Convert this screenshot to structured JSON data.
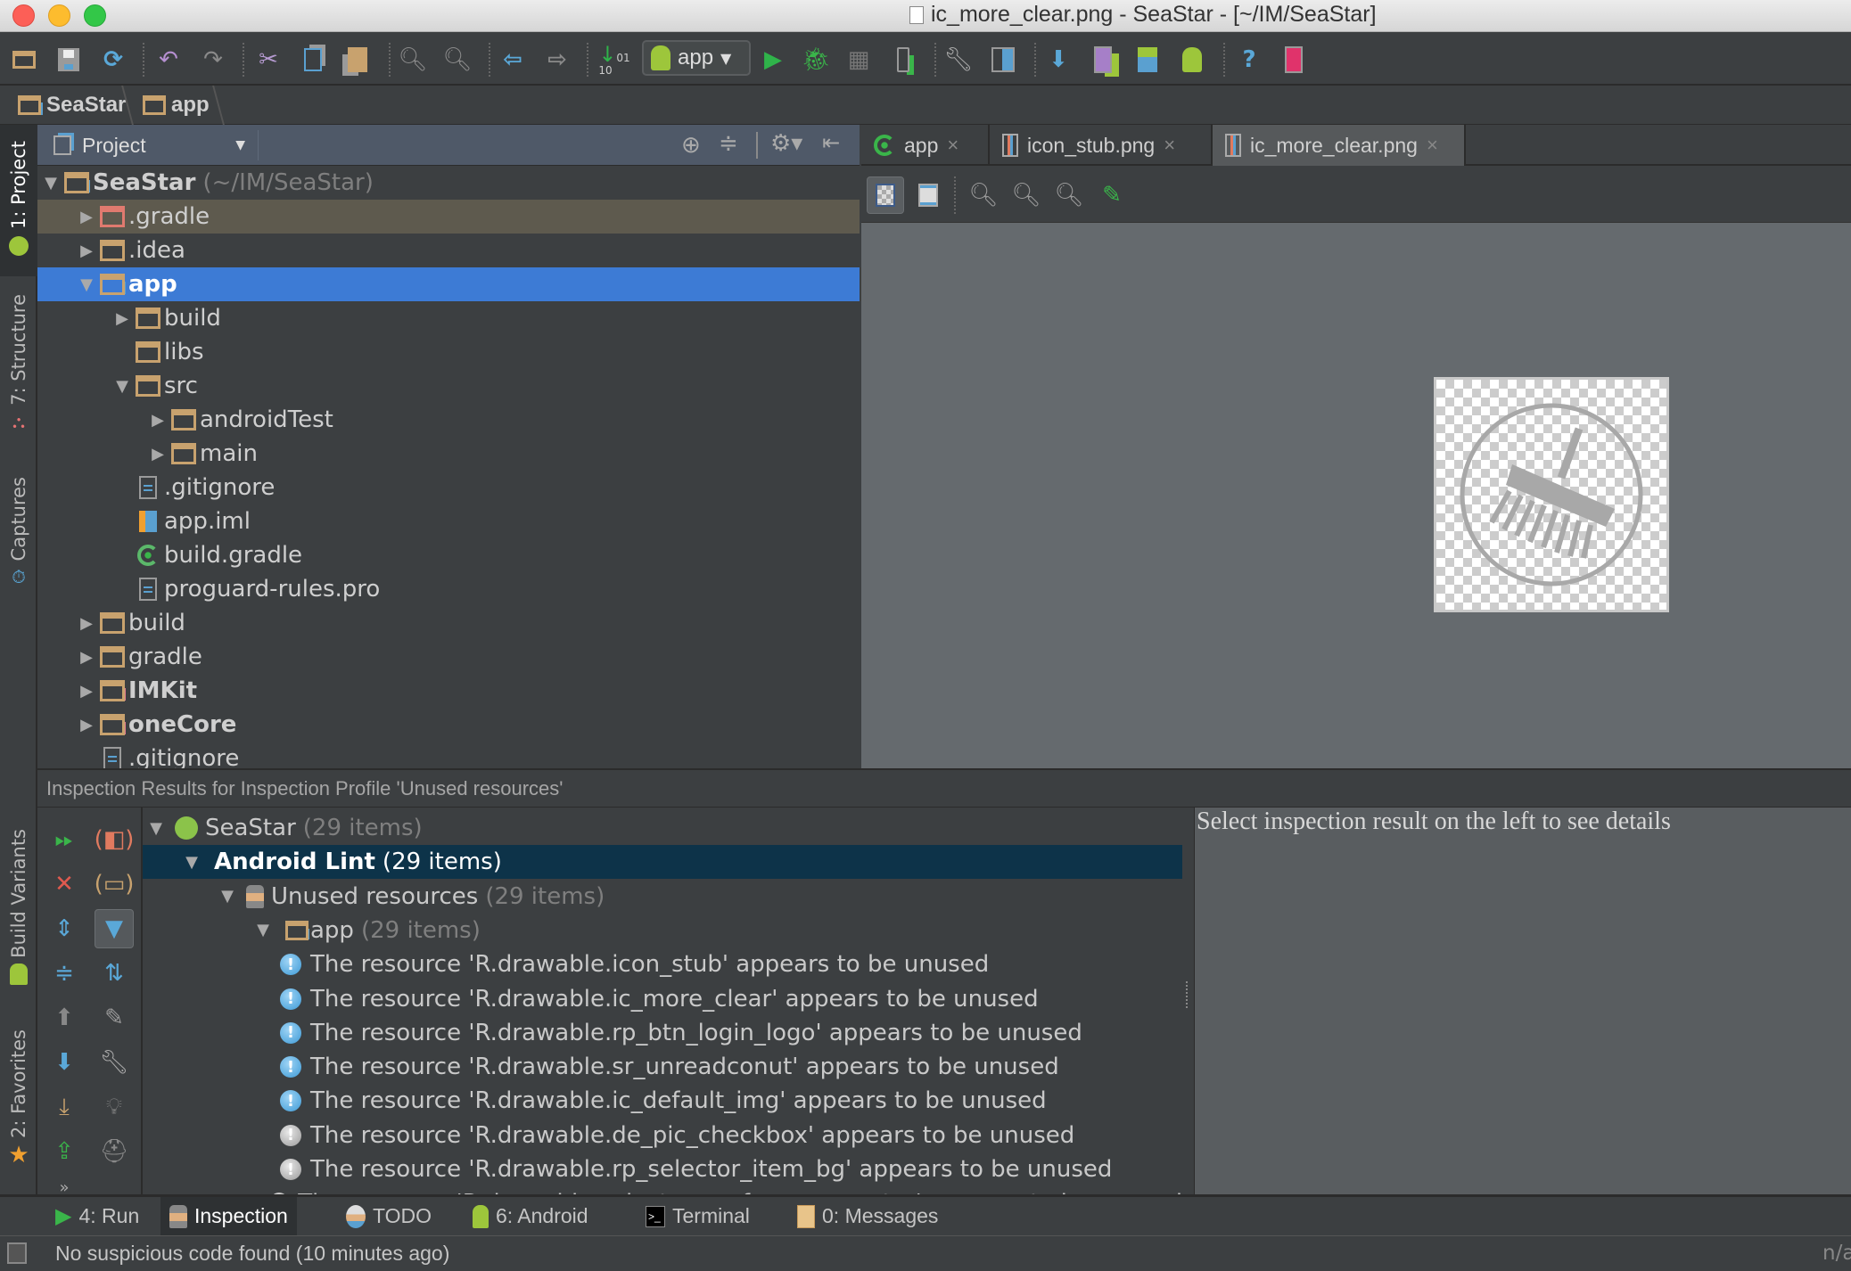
{
  "window": {
    "title": "ic_more_clear.png - SeaStar - [~/IM/SeaStar]",
    "traffic_lights": {
      "close": "#fc5f57",
      "minimize": "#fdbc2e",
      "zoom": "#33c748"
    }
  },
  "toolbar": {
    "buttons": [
      {
        "name": "open-folder",
        "icon": "folder-icon"
      },
      {
        "name": "save-all",
        "icon": "save-icon"
      },
      {
        "name": "synchronize",
        "icon": "sync-icon"
      },
      {
        "name": "undo",
        "icon": "undo-icon"
      },
      {
        "name": "redo",
        "icon": "redo-icon"
      },
      {
        "name": "cut",
        "icon": "scissors-icon"
      },
      {
        "name": "copy",
        "icon": "copy-icon"
      },
      {
        "name": "paste",
        "icon": "paste-icon"
      },
      {
        "name": "find",
        "icon": "search-icon"
      },
      {
        "name": "replace",
        "icon": "search-replace-icon"
      },
      {
        "name": "back",
        "icon": "arrow-left-icon"
      },
      {
        "name": "forward",
        "icon": "arrow-right-icon"
      },
      {
        "name": "make-project",
        "icon": "binary-make-icon"
      },
      {
        "name": "run",
        "icon": "run-icon"
      },
      {
        "name": "debug",
        "icon": "bug-icon"
      },
      {
        "name": "coverage",
        "icon": "coverage-icon"
      },
      {
        "name": "attach-debugger",
        "icon": "attach-device-icon"
      },
      {
        "name": "project-structure",
        "icon": "wrench-icon"
      },
      {
        "name": "sdk-layout",
        "icon": "layout-grid-icon"
      },
      {
        "name": "sync-gradle",
        "icon": "gradle-sync-icon"
      },
      {
        "name": "avd-manager",
        "icon": "avd-icon"
      },
      {
        "name": "sdk-manager",
        "icon": "android-download-icon"
      },
      {
        "name": "android-monitor",
        "icon": "android-icon"
      },
      {
        "name": "help",
        "icon": "question-icon"
      },
      {
        "name": "device-monitor",
        "icon": "device-monitor-icon"
      }
    ],
    "run_config": {
      "label": "app"
    }
  },
  "breadcrumb": [
    {
      "label": "SeaStar"
    },
    {
      "label": "app"
    }
  ],
  "left_strip": [
    {
      "label": "1: Project"
    },
    {
      "label": "7: Structure"
    },
    {
      "label": "Captures"
    },
    {
      "label": "Build Variants"
    },
    {
      "label": "2: Favorites"
    }
  ],
  "project_panel": {
    "view_label": "Project",
    "tree": [
      {
        "label": "SeaStar",
        "suffix": "(~/IM/SeaStar)",
        "depth": 0,
        "arrow": "down",
        "icon": "project-folder-icon",
        "bold": true
      },
      {
        "label": ".gradle",
        "depth": 1,
        "arrow": "right",
        "icon": "folder-excluded-icon",
        "highlight": "excluded"
      },
      {
        "label": ".idea",
        "depth": 1,
        "arrow": "right",
        "icon": "folder-icon"
      },
      {
        "label": "app",
        "depth": 1,
        "arrow": "down",
        "icon": "module-folder-icon",
        "bold": true,
        "selected": true
      },
      {
        "label": "build",
        "depth": 2,
        "arrow": "right",
        "icon": "folder-icon"
      },
      {
        "label": "libs",
        "depth": 2,
        "arrow": "",
        "icon": "folder-icon"
      },
      {
        "label": "src",
        "depth": 2,
        "arrow": "down",
        "icon": "folder-icon"
      },
      {
        "label": "androidTest",
        "depth": 3,
        "arrow": "right",
        "icon": "folder-icon"
      },
      {
        "label": "main",
        "depth": 3,
        "arrow": "right",
        "icon": "folder-icon"
      },
      {
        "label": ".gitignore",
        "depth": 2,
        "arrow": "",
        "icon": "text-file-icon"
      },
      {
        "label": "app.iml",
        "depth": 2,
        "arrow": "",
        "icon": "iml-file-icon"
      },
      {
        "label": "build.gradle",
        "depth": 2,
        "arrow": "",
        "icon": "gradle-file-icon"
      },
      {
        "label": "proguard-rules.pro",
        "depth": 2,
        "arrow": "",
        "icon": "text-file-icon"
      },
      {
        "label": "build",
        "depth": 1,
        "arrow": "right",
        "icon": "folder-icon"
      },
      {
        "label": "gradle",
        "depth": 1,
        "arrow": "right",
        "icon": "folder-icon"
      },
      {
        "label": "IMKit",
        "depth": 1,
        "arrow": "right",
        "icon": "library-module-icon",
        "bold": true
      },
      {
        "label": "oneCore",
        "depth": 1,
        "arrow": "right",
        "icon": "library-module-icon",
        "bold": true
      },
      {
        "label": ".gitignore",
        "depth": 1,
        "arrow": "",
        "icon": "text-file-icon"
      }
    ]
  },
  "editor": {
    "tabs": [
      {
        "label": "app",
        "icon": "gradle-file-icon",
        "active": false
      },
      {
        "label": "icon_stub.png",
        "icon": "image-file-icon",
        "active": false
      },
      {
        "label": "ic_more_clear.png",
        "icon": "image-file-icon",
        "active": true
      }
    ],
    "image_tools": [
      {
        "name": "chessboard",
        "icon": "chessboard-icon",
        "active": true
      },
      {
        "name": "grid",
        "icon": "grid-icon"
      },
      {
        "name": "zoom-in",
        "icon": "zoom-in-icon"
      },
      {
        "name": "zoom-out",
        "icon": "zoom-out-icon"
      },
      {
        "name": "actual-size",
        "icon": "zoom-actual-icon"
      },
      {
        "name": "color-picker",
        "icon": "eyedropper-icon"
      }
    ],
    "preview_image": "broom-in-circle-icon"
  },
  "inspection": {
    "title": "Inspection Results for Inspection Profile 'Unused resources'",
    "tools_left": [
      "rerun-icon",
      "close-icon",
      "expand-all-icon",
      "collapse-all-icon",
      "previous-icon",
      "next-icon",
      "export-icon",
      "export-html-icon"
    ],
    "tools_right": [
      "group-by-severity-icon",
      "group-by-directory-icon",
      "filter-icon",
      "autoscroll-icon",
      "edit-settings-icon",
      "quick-fix-icon",
      "suppress-icon",
      "offline-view-icon"
    ],
    "tree": [
      {
        "label": "SeaStar",
        "count": "(29 items)",
        "depth": 0,
        "icon": "android-studio-icon"
      },
      {
        "label": "Android Lint",
        "count": "(29 items)",
        "depth": 1,
        "selected": true
      },
      {
        "label": "Unused resources",
        "count": "(29 items)",
        "depth": 2,
        "icon": "inspector-icon"
      },
      {
        "label": "app",
        "count": "(29 items)",
        "depth": 3,
        "icon": "module-folder-icon"
      }
    ],
    "problems": [
      {
        "text": "The resource 'R.drawable.icon_stub' appears to be unused",
        "severity": "info"
      },
      {
        "text": "The resource 'R.drawable.ic_more_clear' appears to be unused",
        "severity": "info"
      },
      {
        "text": "The resource 'R.drawable.rp_btn_login_logo' appears to be unused",
        "severity": "info"
      },
      {
        "text": "The resource 'R.drawable.sr_unreadconut' appears to be unused",
        "severity": "info"
      },
      {
        "text": "The resource 'R.drawable.ic_default_img' appears to be unused",
        "severity": "info"
      },
      {
        "text": "The resource 'R.drawable.de_pic_checkbox' appears to be unused",
        "severity": "weak"
      },
      {
        "text": "The resource 'R.drawable.rp_selector_item_bg' appears to be unused",
        "severity": "weak"
      },
      {
        "text": "The resource 'R.drawable.selector_preference_center' appears to be unused",
        "severity": "weak"
      }
    ],
    "detail_text": "Select inspection result on the left to see details"
  },
  "tool_windows": [
    {
      "label": "4: Run",
      "icon": "run-icon",
      "active": false
    },
    {
      "label": "Inspection",
      "icon": "inspector-icon",
      "active": true
    },
    {
      "label": "TODO",
      "icon": "todo-icon",
      "active": false
    },
    {
      "label": "6: Android",
      "icon": "android-icon",
      "active": false
    },
    {
      "label": "Terminal",
      "icon": "terminal-icon",
      "active": false
    },
    {
      "label": "0: Messages",
      "icon": "messages-icon",
      "active": false
    }
  ],
  "status": {
    "message": "No suspicious code found (10 minutes ago)",
    "right": "n/a"
  },
  "colors": {
    "selection_blue": "#3d7bd5",
    "inspection_selection": "#0d3349",
    "excluded_row": "#5e5a4e",
    "panel_bg": "#3c3f41"
  }
}
